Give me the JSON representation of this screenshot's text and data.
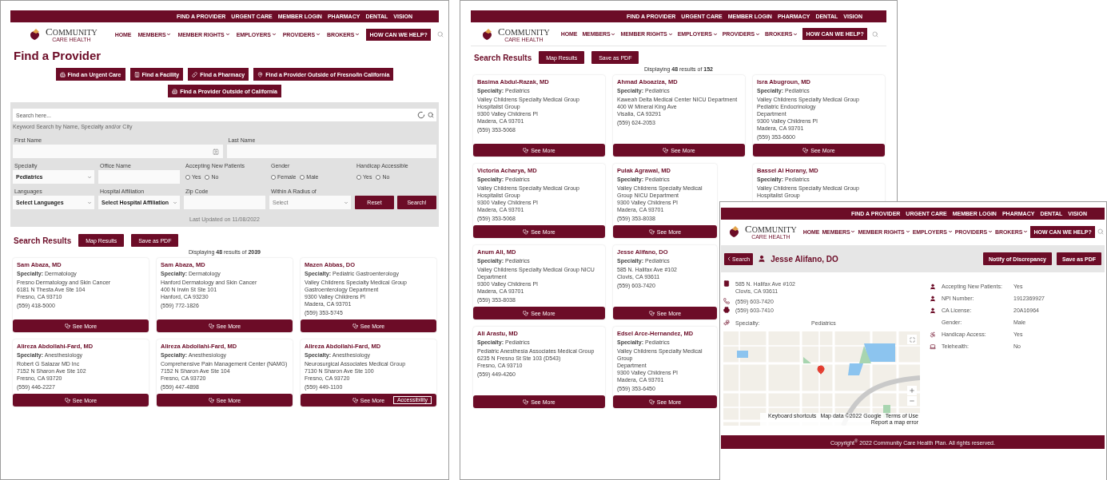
{
  "windows": [
    {
      "kind": "search",
      "utility_links": [
        "FIND A PROVIDER",
        "URGENT CARE",
        "MEMBER LOGIN",
        "PHARMACY",
        "DENTAL",
        "VISION"
      ],
      "logo": {
        "name": "COMMUNITY",
        "tagline": "CARE HEALTH"
      },
      "nav": [
        {
          "label": "HOME",
          "has_menu": false
        },
        {
          "label": "MEMBERS",
          "has_menu": true
        },
        {
          "label": "MEMBER RIGHTS",
          "has_menu": true
        },
        {
          "label": "EMPLOYERS",
          "has_menu": true
        },
        {
          "label": "PROVIDERS",
          "has_menu": true
        },
        {
          "label": "BROKERS",
          "has_menu": true
        }
      ],
      "cta": "HOW CAN WE HELP?",
      "title": "Find a Provider",
      "quick_links": [
        "Find an Urgent Care",
        "Find a Facility",
        "Find a Pharmacy",
        "Find a Provider Outside of Fresno/In California",
        "Find a Provider Outside of California"
      ],
      "search": {
        "placeholder": "Search here...",
        "hint": "Keyword Search by Name, Specialty and/or City"
      },
      "form_rows": [
        [
          {
            "kind": "text",
            "label": "First Name"
          },
          {
            "kind": "text",
            "label": "Last Name"
          }
        ],
        [
          {
            "kind": "select",
            "label": "Specialty",
            "value": "Pediatrics"
          },
          {
            "kind": "text",
            "label": "Office Name"
          },
          {
            "kind": "radio",
            "label": "Accepting New Patients",
            "options": [
              {
                "label": "Yes",
                "selected": false
              },
              {
                "label": "No",
                "selected": false
              }
            ]
          },
          {
            "kind": "radio",
            "label": "Gender",
            "options": [
              {
                "label": "Female",
                "selected": false
              },
              {
                "label": "Male",
                "selected": false
              }
            ]
          },
          {
            "kind": "radio",
            "label": "Handicap Accessible",
            "options": [
              {
                "label": "Yes",
                "selected": false
              },
              {
                "label": "No",
                "selected": false
              }
            ]
          }
        ],
        [
          {
            "kind": "select",
            "label": "Languages",
            "value": "Select Languages"
          },
          {
            "kind": "select",
            "label": "Hospital Affiliation",
            "value": "Select Hospital Affiliation"
          },
          {
            "kind": "text",
            "label": "Zip Code"
          },
          {
            "kind": "select",
            "label": "Within A Radius of",
            "placeholder": "Select"
          },
          {
            "kind": "actions",
            "buttons": [
              "Reset",
              "Search!"
            ]
          }
        ]
      ],
      "last_updated": "Last Updated on 11/08/2022",
      "results": {
        "title": "Search Results",
        "buttons": [
          "Map Results",
          "Save as PDF"
        ],
        "count": "Displaying **48** results of **2039**",
        "rows": [
          [
            {
              "name": "Sam Abaza, MD",
              "specialty": "**Specialty:** Dermatology",
              "lines": [
                "Fresno Dermatology and Skin Cancer",
                "6181 N Thesta Ave Ste 104",
                "Fresno, CA 93710"
              ],
              "phone": "(559) 418-5000",
              "button": "See More"
            },
            {
              "name": "Sam Abaza, MD",
              "specialty": "**Specialty:** Dermatology",
              "lines": [
                "Hanford Dermatology and Skin Cancer",
                "400 N Irwin St Ste 101",
                "Hanford, CA 93230"
              ],
              "phone": "(559) 772-1826",
              "button": "See More"
            },
            {
              "name": "Mazen Abbas, DO",
              "specialty": "**Specialty:** Pediatric Gastroenterology",
              "lines": [
                "Valley Childrens Specialty Medical Group Gastroenterology Department",
                "9300 Valley Childrens Pl",
                "Madera, CA 93701"
              ],
              "phone": "(559) 353-5745",
              "button": "See More"
            }
          ],
          [
            {
              "name": "Alireza Abdollahi-Fard, MD",
              "specialty": "**Specialty:** Anesthesiology",
              "lines": [
                "Robert G Salazar MD Inc",
                "7152 N Sharon Ave Ste 102",
                "Fresno, CA 93720"
              ],
              "phone": "(559) 446-2227",
              "button": "See More"
            },
            {
              "name": "Alireza Abdollahi-Fard, MD",
              "specialty": "**Specialty:** Anesthesiology",
              "lines": [
                "Comprehensive Pain Management Center (NAMG)",
                "7152 N Sharon Ave Ste 104",
                "Fresno, CA 93720"
              ],
              "phone": "(559) 447-4898",
              "button": "See More"
            },
            {
              "name": "Alireza Abdollahi-Fard, MD",
              "specialty": "**Specialty:** Anesthesiology",
              "lines": [
                "Neurosurgical Associates Medical Group",
                "7130 N Sharon Ave Ste 100",
                "Fresno, CA 93720"
              ],
              "phone": "(559) 449-1100",
              "button": "See More",
              "badge": "Accessibility"
            }
          ]
        ]
      }
    },
    {
      "kind": "results",
      "utility_links": [
        "FIND A PROVIDER",
        "URGENT CARE",
        "MEMBER LOGIN",
        "PHARMACY",
        "DENTAL",
        "VISION"
      ],
      "logo": {
        "name": "COMMUNITY",
        "tagline": "CARE HEALTH"
      },
      "nav": [
        {
          "label": "HOME",
          "has_menu": false
        },
        {
          "label": "MEMBERS",
          "has_menu": true
        },
        {
          "label": "MEMBER RIGHTS",
          "has_menu": true
        },
        {
          "label": "EMPLOYERS",
          "has_menu": true
        },
        {
          "label": "PROVIDERS",
          "has_menu": true
        },
        {
          "label": "BROKERS",
          "has_menu": true
        }
      ],
      "cta": "HOW CAN WE HELP?",
      "results": {
        "title": "Search Results",
        "buttons": [
          "Map Results",
          "Save as PDF"
        ],
        "count": "Displaying **48** results of **152**",
        "rows": [
          [
            {
              "name": "Basima Abdul-Razak, MD",
              "specialty": "**Specialty:** Pediatrics",
              "lines": [
                "Valley Childrens Specialty Medical Group Hospitalist Group",
                "9300 Valley Childrens Pl",
                "Madera, CA 93701"
              ],
              "phone": "(559) 353-5068",
              "button": "See More"
            },
            {
              "name": "Ahmad Aboaziza, MD",
              "specialty": "**Specialty:** Pediatrics",
              "lines": [
                "Kaweah Delta Medical Center NICU Department",
                "400 W Mineral King Ave",
                "Visalia, CA 93291"
              ],
              "phone": "(559) 624-2053",
              "button": "See More"
            },
            {
              "name": "Isra Abugroun, MD",
              "specialty": "**Specialty:** Pediatrics",
              "lines": [
                "Valley Childrens Specialty Medical Group Pediatric Endocrinology",
                "Department",
                "9300 Valley Childrens Pl",
                "Madera, CA 93701"
              ],
              "phone": "(559) 353-6600",
              "button": "See More"
            }
          ],
          [
            {
              "name": "Victoria Acharya, MD",
              "specialty": "**Specialty:** Pediatrics",
              "lines": [
                "Valley Childrens Specialty Medical Group Hospitalist Group",
                "9300 Valley Childrens Pl",
                "Madera, CA 93701"
              ],
              "phone": "(559) 353-5068",
              "button": "See More"
            },
            {
              "name": "Pulak Agrawal, MD",
              "specialty": "**Specialty:** Pediatrics",
              "lines": [
                "Valley Childrens Specialty Medical Group NICU Department",
                "9300 Valley Childrens Pl",
                "Madera, CA 93701"
              ],
              "phone": "(559) 353-8038",
              "button": "See More"
            },
            {
              "name": "Bassel Al Horany, MD",
              "specialty": "**Specialty:** Pediatrics",
              "lines": [
                "Valley Childrens Specialty Medical Group Hospitalist Group"
              ]
            }
          ],
          [
            {
              "name": "Anum Ali, MD",
              "specialty": "**Specialty:** Pediatrics",
              "lines": [
                "Valley Childrens Specialty Medical Group NICU Department",
                "9300 Valley Childrens Pl",
                "Madera, CA 93701"
              ],
              "phone": "(559) 353-8038",
              "button": "See More"
            },
            {
              "name": "Jesse Alifano, DO",
              "specialty": "**Specialty:** Pediatrics",
              "lines": [
                "585 N. Halifax Ave #102",
                "Clovis, CA 93611"
              ],
              "phone": "(559) 603-7420",
              "button": "See More"
            }
          ],
          [
            {
              "name": "Ali Arastu, MD",
              "specialty": "**Specialty:** Pediatrics",
              "lines": [
                "Pediatric Anesthesia Associates Medical Group",
                "6235 N Fresno St Ste 103 (D543)",
                "Fresno, CA 93710"
              ],
              "phone": "(559) 449-4260",
              "button": "See More"
            },
            {
              "name": "Edsel Arce-Hernandez, MD",
              "specialty": "**Specialty:** Pediatrics",
              "lines": [
                "Valley Childrens Specialty Medical Group",
                "Department",
                "9300 Valley Childrens Pl",
                "Madera, CA 93701"
              ],
              "phone": "(559) 353-6450",
              "button": "See More"
            }
          ]
        ]
      }
    },
    {
      "kind": "detail",
      "utility_links": [
        "FIND A PROVIDER",
        "URGENT CARE",
        "MEMBER LOGIN",
        "PHARMACY",
        "DENTAL",
        "VISION"
      ],
      "logo": {
        "name": "COMMUNITY",
        "tagline": "CARE HEALTH"
      },
      "nav": [
        {
          "label": "HOME",
          "has_menu": false
        },
        {
          "label": "MEMBERS",
          "has_menu": true
        },
        {
          "label": "MEMBER RIGHTS",
          "has_menu": true
        },
        {
          "label": "EMPLOYERS",
          "has_menu": true
        },
        {
          "label": "PROVIDERS",
          "has_menu": true
        },
        {
          "label": "BROKERS",
          "has_menu": true
        }
      ],
      "cta": "HOW CAN WE HELP?",
      "back": "Search",
      "provider": "Jesse Alifano, DO",
      "actions": [
        "Notify of Discrepancy",
        "Save as PDF"
      ],
      "contact": [
        {
          "lines": [
            "585 N. Halifax Ave #102",
            "Clovis, CA 93611"
          ]
        },
        {
          "lines": [
            "(559) 603-7420"
          ]
        },
        {
          "lines": [
            "(559) 603-7410"
          ]
        }
      ],
      "specialty": {
        "label": "Specialty:",
        "value": "Pediatrics"
      },
      "facts": [
        {
          "label": "Accepting New Patients:",
          "value": "Yes"
        },
        {
          "label": "NPI Number:",
          "value": "1912369927"
        },
        {
          "label": "CA License:",
          "value": "20A16964"
        },
        {
          "label": "Gender:",
          "value": "Male"
        },
        {
          "label": "Handicap Access:",
          "value": "Yes"
        },
        {
          "label": "Telehealth:",
          "value": "No"
        }
      ],
      "map_credits": [
        "Keyboard shortcuts",
        "Map data ©2022 Google",
        "Terms of Use",
        "Report a map error"
      ],
      "footer": "Copyright$^{®}$ 2022 Community Care Health Plan. All rights reserved."
    }
  ]
}
